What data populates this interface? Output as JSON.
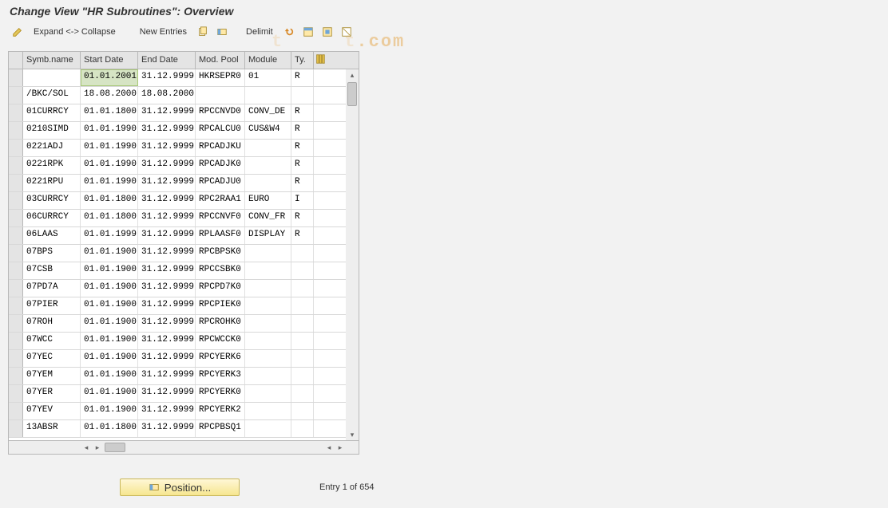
{
  "title": "Change View \"HR Subroutines\": Overview",
  "watermark": ".com",
  "toolbar": {
    "expand_collapse": "Expand <-> Collapse",
    "new_entries": "New Entries",
    "delimit": "Delimit",
    "icons": {
      "pencil": "pencil-icon",
      "copy": "copy-icon",
      "select": "select-icon",
      "undo": "undo-icon",
      "sel_all": "select-all-icon",
      "sel_block": "select-block-icon",
      "desel": "deselect-icon"
    }
  },
  "columns": {
    "symb": "Symb.name",
    "start": "Start Date",
    "end": "End Date",
    "pool": "Mod. Pool",
    "module": "Module",
    "ty": "Ty."
  },
  "rows": [
    {
      "symb": "",
      "start": "01.01.2001",
      "end": "31.12.9999",
      "pool": "HKRSEPR0",
      "module": "01",
      "ty": "R",
      "sel_start": true
    },
    {
      "symb": "/BKC/SOL",
      "start": "18.08.2000",
      "end": "18.08.2000",
      "pool": "",
      "module": "",
      "ty": ""
    },
    {
      "symb": "01CURRCY",
      "start": "01.01.1800",
      "end": "31.12.9999",
      "pool": "RPCCNVD0",
      "module": "CONV_DE",
      "ty": "R"
    },
    {
      "symb": "0210SIMD",
      "start": "01.01.1990",
      "end": "31.12.9999",
      "pool": "RPCALCU0",
      "module": "CUS&W4",
      "ty": "R"
    },
    {
      "symb": "0221ADJ",
      "start": "01.01.1990",
      "end": "31.12.9999",
      "pool": "RPCADJKU",
      "module": "",
      "ty": "R"
    },
    {
      "symb": "0221RPK",
      "start": "01.01.1990",
      "end": "31.12.9999",
      "pool": "RPCADJK0",
      "module": "",
      "ty": "R"
    },
    {
      "symb": "0221RPU",
      "start": "01.01.1990",
      "end": "31.12.9999",
      "pool": "RPCADJU0",
      "module": "",
      "ty": "R"
    },
    {
      "symb": "03CURRCY",
      "start": "01.01.1800",
      "end": "31.12.9999",
      "pool": "RPC2RAA1",
      "module": "EURO",
      "ty": "I"
    },
    {
      "symb": "06CURRCY",
      "start": "01.01.1800",
      "end": "31.12.9999",
      "pool": "RPCCNVF0",
      "module": "CONV_FR",
      "ty": "R"
    },
    {
      "symb": "06LAAS",
      "start": "01.01.1999",
      "end": "31.12.9999",
      "pool": "RPLAASF0",
      "module": "DISPLAY",
      "ty": "R"
    },
    {
      "symb": "07BPS",
      "start": "01.01.1900",
      "end": "31.12.9999",
      "pool": "RPCBPSK0",
      "module": "",
      "ty": ""
    },
    {
      "symb": "07CSB",
      "start": "01.01.1900",
      "end": "31.12.9999",
      "pool": "RPCCSBK0",
      "module": "",
      "ty": ""
    },
    {
      "symb": "07PD7A",
      "start": "01.01.1900",
      "end": "31.12.9999",
      "pool": "RPCPD7K0",
      "module": "",
      "ty": ""
    },
    {
      "symb": "07PIER",
      "start": "01.01.1900",
      "end": "31.12.9999",
      "pool": "RPCPIEK0",
      "module": "",
      "ty": ""
    },
    {
      "symb": "07ROH",
      "start": "01.01.1900",
      "end": "31.12.9999",
      "pool": "RPCROHK0",
      "module": "",
      "ty": ""
    },
    {
      "symb": "07WCC",
      "start": "01.01.1900",
      "end": "31.12.9999",
      "pool": "RPCWCCK0",
      "module": "",
      "ty": ""
    },
    {
      "symb": "07YEC",
      "start": "01.01.1900",
      "end": "31.12.9999",
      "pool": "RPCYERK6",
      "module": "",
      "ty": ""
    },
    {
      "symb": "07YEM",
      "start": "01.01.1900",
      "end": "31.12.9999",
      "pool": "RPCYERK3",
      "module": "",
      "ty": ""
    },
    {
      "symb": "07YER",
      "start": "01.01.1900",
      "end": "31.12.9999",
      "pool": "RPCYERK0",
      "module": "",
      "ty": ""
    },
    {
      "symb": "07YEV",
      "start": "01.01.1900",
      "end": "31.12.9999",
      "pool": "RPCYERK2",
      "module": "",
      "ty": ""
    },
    {
      "symb": "13ABSR",
      "start": "01.01.1800",
      "end": "31.12.9999",
      "pool": "RPCPBSQ1",
      "module": "",
      "ty": ""
    }
  ],
  "footer": {
    "position_btn": "Position...",
    "entry_text": "Entry 1 of 654"
  }
}
